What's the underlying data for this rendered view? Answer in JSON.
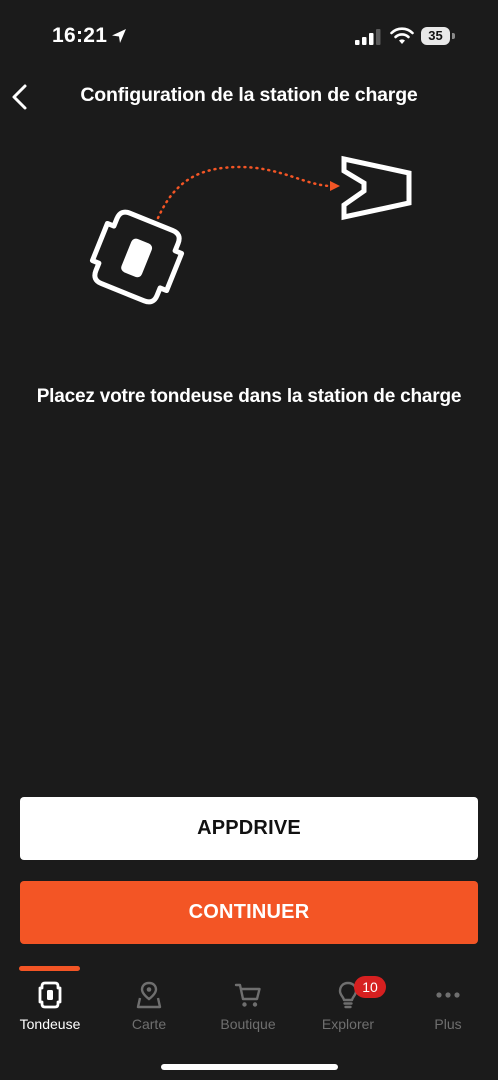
{
  "status_bar": {
    "time": "16:21",
    "battery": "35",
    "icons": [
      "location-arrow-icon",
      "cellular-signal-icon",
      "wifi-icon",
      "battery-icon"
    ]
  },
  "header": {
    "title": "Configuration de la station de charge",
    "back_icon": "chevron-left-icon"
  },
  "illustration": {
    "icons": [
      "mower-icon",
      "dotted-path-arrow",
      "charging-station-icon"
    ],
    "accent_color": "#f35525"
  },
  "instruction": "Placez votre tondeuse dans la station de charge",
  "buttons": {
    "appdrive": "APPDRIVE",
    "continue": "CONTINUER"
  },
  "tab_bar": {
    "active_color": "#f35525",
    "tabs": [
      {
        "label": "Tondeuse",
        "icon": "mower-icon",
        "active": true
      },
      {
        "label": "Carte",
        "icon": "map-pin-icon",
        "active": false
      },
      {
        "label": "Boutique",
        "icon": "cart-icon",
        "active": false
      },
      {
        "label": "Explorer",
        "icon": "lightbulb-icon",
        "active": false,
        "badge": "10"
      },
      {
        "label": "Plus",
        "icon": "more-dots-icon",
        "active": false
      }
    ]
  },
  "colors": {
    "background": "#1b1b1b",
    "accent": "#f35525",
    "badge": "#d62020"
  }
}
